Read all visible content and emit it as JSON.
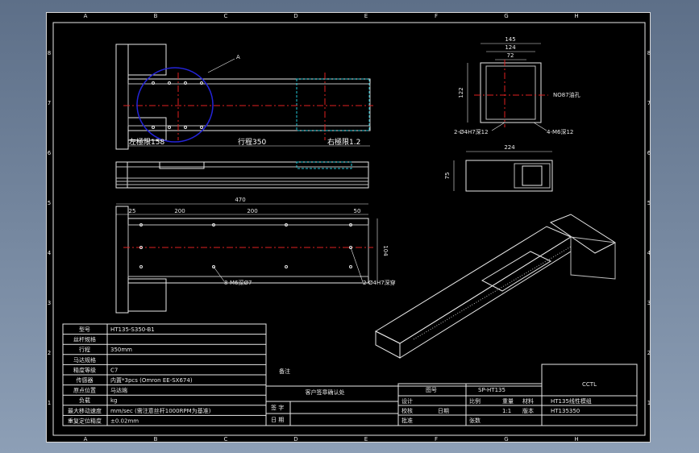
{
  "border": {
    "columns": [
      "A",
      "B",
      "C",
      "D",
      "E",
      "F",
      "G",
      "H"
    ],
    "rows": [
      "8",
      "7",
      "6",
      "5",
      "4",
      "3",
      "2",
      "1"
    ]
  },
  "top_view": {
    "callout": "A",
    "left_limit": "左極限158",
    "stroke": "行程350",
    "right_limit": "右極限1.2"
  },
  "bottom_view": {
    "overall": "470",
    "dim_25": "25",
    "dim_200a": "200",
    "dim_200b": "200",
    "dim_50": "50",
    "dim_104": "104",
    "note_m6": "8-M6深Ø7",
    "note_thru": "2-Ø4H7深穿"
  },
  "end_view": {
    "dim_145": "145",
    "dim_124": "124",
    "dim_72": "72",
    "dim_122": "122",
    "dim_224": "224",
    "dim_75": "75",
    "note_holes": "2-Ø4H7深12",
    "note_m6": "4-M6深12",
    "note_motor": "NO87油孔"
  },
  "title_block": {
    "rows": [
      {
        "label": "型号",
        "value": "HT135-S350-B1"
      },
      {
        "label": "丝杆规格",
        "value": ""
      },
      {
        "label": "行程",
        "value": "350mm"
      },
      {
        "label": "马达规格",
        "value": ""
      },
      {
        "label": "精度等级",
        "value": "C7"
      },
      {
        "label": "传感器",
        "value": "内置*3pcs (Omron EE-SX674)"
      },
      {
        "label": "原点位置",
        "value": "马达端"
      },
      {
        "label": "负载",
        "value": "kg"
      },
      {
        "label": "最大移动速度",
        "value": "mm/sec (需注意丝杆1000RPM为基准)"
      },
      {
        "label": "重复定位精度",
        "value": "±0.02mm"
      }
    ],
    "remark": "备注",
    "confirm_title": "客户签章确认处",
    "sign_label": "签 字",
    "date_label": "日 期",
    "company": "CCTL",
    "drawing_no_label": "图号",
    "drawing_no": "SP-HT135",
    "part_name": "HT135线性模组",
    "design": "设计",
    "check": "校核",
    "approve": "批准",
    "date": "日期",
    "ratio": "比例",
    "scale": "1:1",
    "sheet": "张数",
    "weight": "重量",
    "material": "材料",
    "version": "版本",
    "code": "HT135350"
  }
}
